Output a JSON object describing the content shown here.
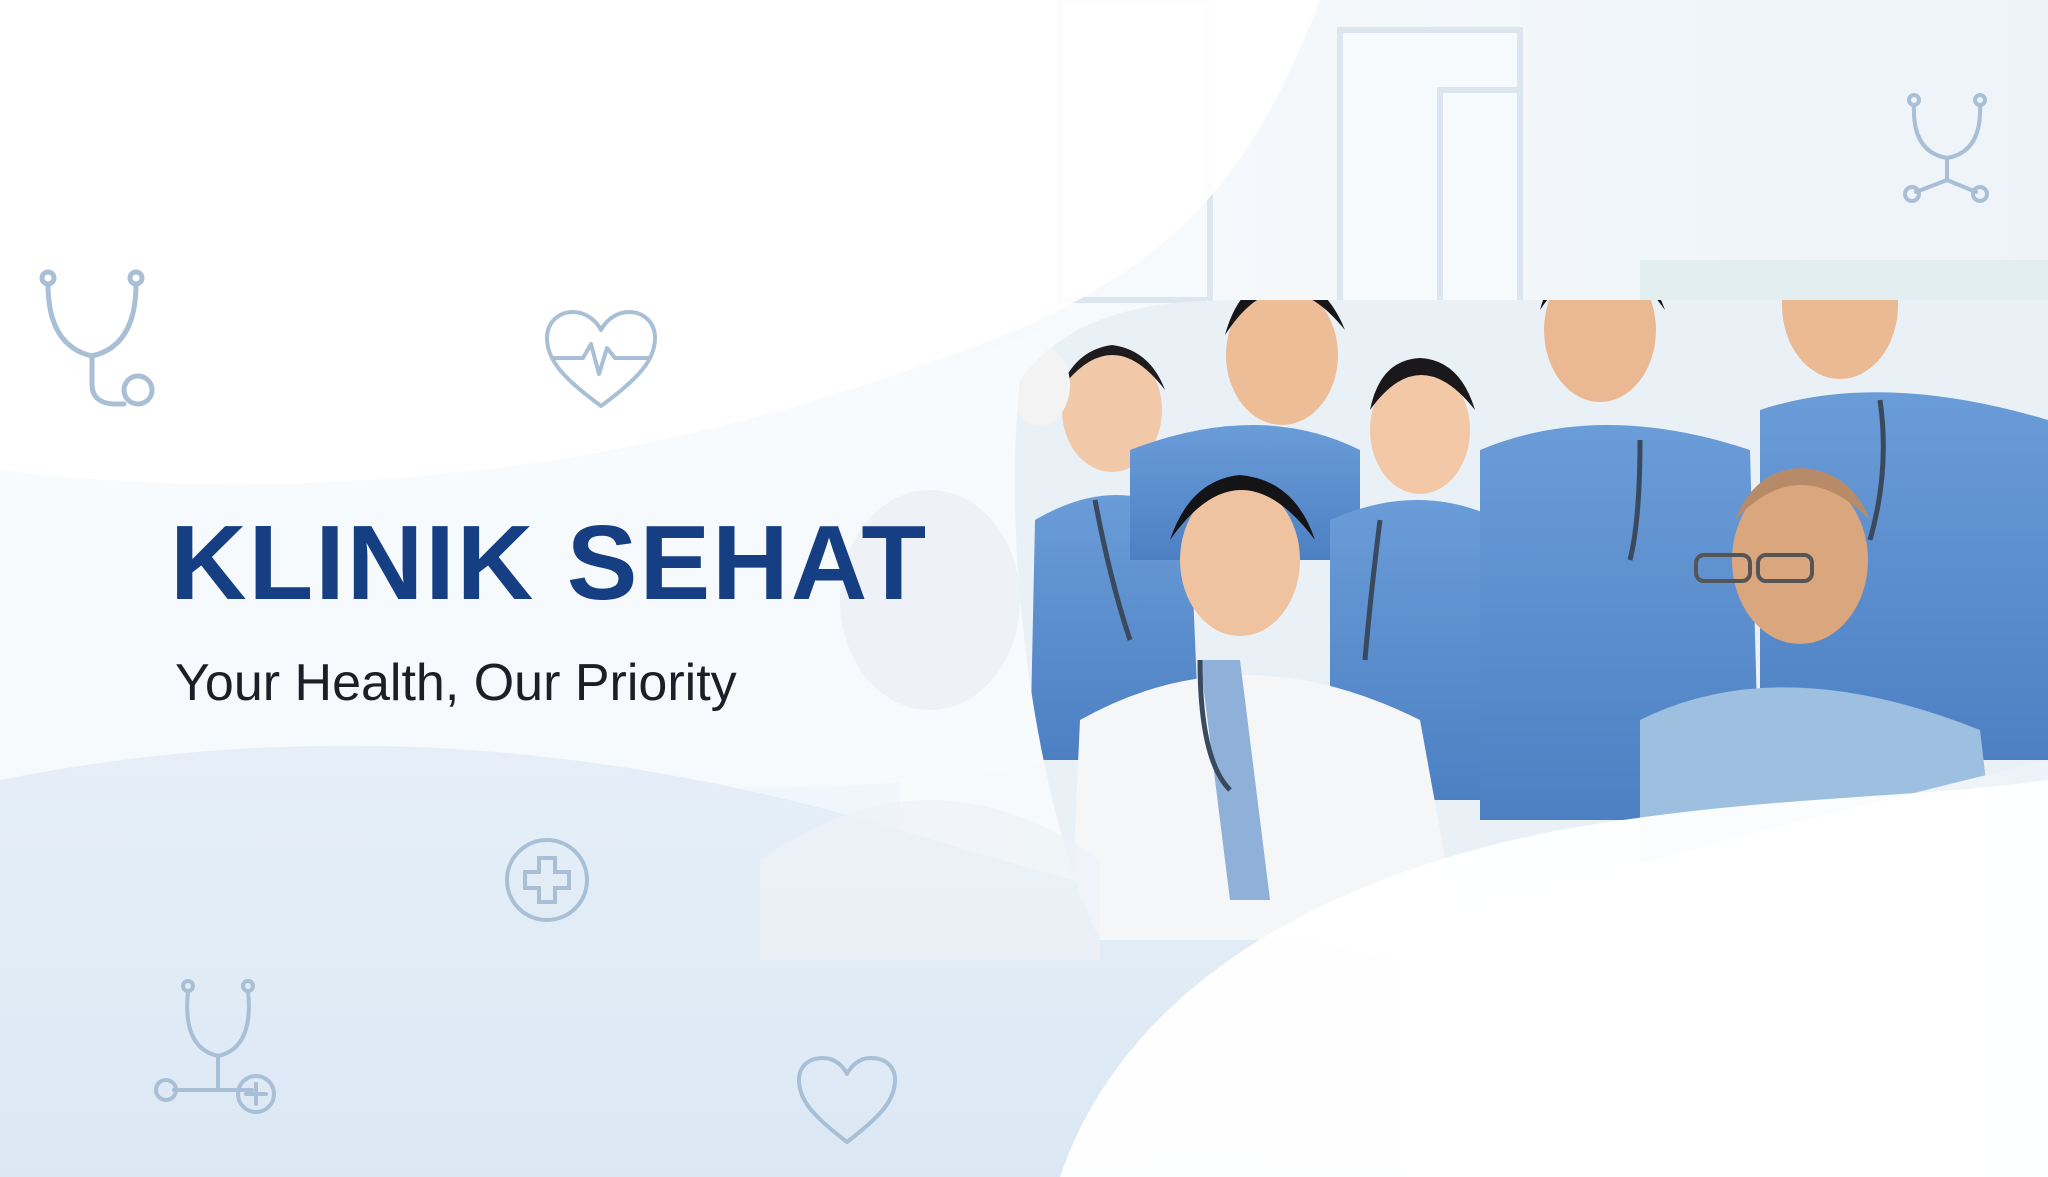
{
  "banner": {
    "title": "KLINIK SEHAT",
    "tagline": "Your Health, Our Priority"
  },
  "colors": {
    "title": "#153f82",
    "tagline": "#1c1f26",
    "scrubs": "#5b8fcf",
    "background": "#f3f7fb",
    "icon_outline": "#a9bfd6"
  },
  "photo": {
    "subject": "group of medical staff in blue scrubs and a white coat, smiling together in a bright hospital corridor"
  },
  "decorative_icons": [
    "stethoscope-icon",
    "heartbeat-icon",
    "stethoscope-icon",
    "medical-cross-icon",
    "stethoscope-plus-icon",
    "heart-icon"
  ]
}
